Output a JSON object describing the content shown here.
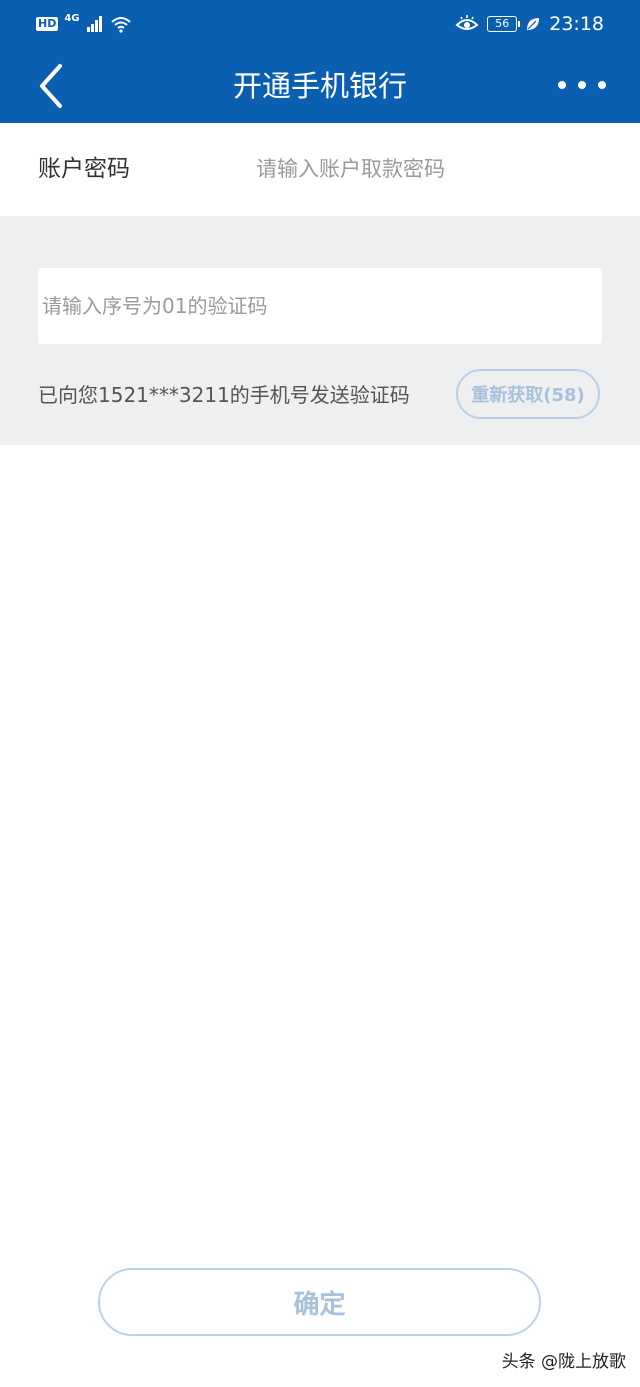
{
  "status_bar": {
    "hd_badge": "HD",
    "network": "4G",
    "battery_level": "56",
    "time": "23:18"
  },
  "nav": {
    "title": "开通手机银行"
  },
  "form": {
    "password_label": "账户密码",
    "password_placeholder": "请输入账户取款密码",
    "code_placeholder": "请输入序号为01的验证码",
    "sent_message": "已向您1521***3211的手机号发送验证码",
    "resend_label": "重新获取(58)",
    "confirm_label": "确定"
  },
  "watermark": "头条 @陇上放歌",
  "colors": {
    "header": "#0B5FB0",
    "section_bg": "#EEEFF1",
    "disabled_button": "#A9C2DC"
  }
}
